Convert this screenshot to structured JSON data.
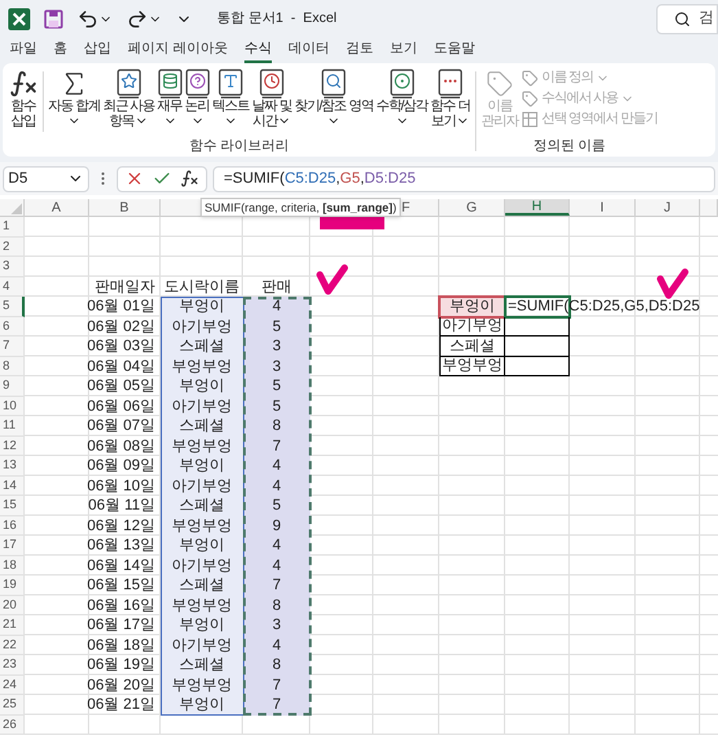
{
  "title_bar": {
    "title": "통합 문서1  -  Excel",
    "search": {
      "placeholder": "검"
    }
  },
  "tabs": [
    {
      "label": "파일",
      "selected": false
    },
    {
      "label": "홈",
      "selected": false
    },
    {
      "label": "삽입",
      "selected": false
    },
    {
      "label": "페이지 레이아웃",
      "selected": false
    },
    {
      "label": "수식",
      "selected": true
    },
    {
      "label": "데이터",
      "selected": false
    },
    {
      "label": "검토",
      "selected": false
    },
    {
      "label": "보기",
      "selected": false
    },
    {
      "label": "도움말",
      "selected": false
    }
  ],
  "function_library": {
    "title": "함수 라이브러리",
    "buttons": [
      {
        "kind": "fx",
        "label": "함수\n삽입",
        "dropdown": false
      },
      {
        "kind": "sigma",
        "label": "자동 합계",
        "dropdown": true
      },
      {
        "kind": "star",
        "label": "최근 사용\n항목",
        "dropdown": true
      },
      {
        "kind": "database",
        "label": "재무",
        "dropdown": true
      },
      {
        "kind": "question",
        "label": "논리",
        "dropdown": true
      },
      {
        "kind": "text",
        "label": "텍스트",
        "dropdown": true
      },
      {
        "kind": "clock",
        "label": "날짜 및\n시간",
        "dropdown": true
      },
      {
        "kind": "search",
        "label": "찾기/참조 영역",
        "dropdown": true
      },
      {
        "kind": "theta",
        "label": "수학/삼각",
        "dropdown": true
      },
      {
        "kind": "dots",
        "label": "함수 더\n보기",
        "dropdown": true
      }
    ]
  },
  "defined_names": {
    "title": "정의된 이름",
    "manager": {
      "label": "이름\n관리자",
      "disabled": true
    },
    "items": [
      {
        "kind": "tag",
        "label": "이름 정의",
        "dropdown": true,
        "disabled": true
      },
      {
        "kind": "formula",
        "label": "수식에서 사용",
        "dropdown": true,
        "disabled": true
      },
      {
        "kind": "table",
        "label": "선택 영역에서 만들기",
        "dropdown": false,
        "disabled": true
      }
    ]
  },
  "formula_bar": {
    "name_box": "D5",
    "segments": [
      {
        "text": "=SUMIF("
      },
      {
        "text": "C5:D25",
        "color": "#2f6db5"
      },
      {
        "text": ","
      },
      {
        "text": "G5",
        "color": "#c0504d"
      },
      {
        "text": ","
      },
      {
        "text": "D5:D25",
        "color": "#7a5ca8"
      }
    ]
  },
  "tooltip": "SUMIF(range, criteria, **[sum_range]**)",
  "sheet": {
    "columns": [
      {
        "label": "A",
        "selected": false
      },
      {
        "label": "B",
        "selected": false
      },
      {},
      {},
      {},
      {
        "label": "F",
        "selected": false
      },
      {
        "label": "G",
        "selected": false
      },
      {
        "label": "H",
        "selected": true
      },
      {
        "label": "I",
        "selected": false
      },
      {
        "label": "J",
        "selected": false
      }
    ],
    "rows": [
      {
        "label": "1",
        "selected": false
      },
      {
        "label": "2",
        "selected": false
      },
      {
        "label": "3",
        "selected": false
      },
      {
        "label": "4",
        "selected": false
      },
      {
        "label": "5",
        "selected": true
      },
      {
        "label": "6",
        "selected": false
      },
      {
        "label": "7",
        "selected": false
      },
      {
        "label": "8",
        "selected": false
      },
      {
        "label": "9",
        "selected": false
      },
      {
        "label": "10",
        "selected": false
      },
      {
        "label": "11",
        "selected": false
      },
      {
        "label": "12",
        "selected": false
      },
      {
        "label": "13",
        "selected": false
      },
      {
        "label": "14",
        "selected": false
      },
      {
        "label": "15",
        "selected": false
      },
      {
        "label": "16",
        "selected": false
      },
      {
        "label": "17",
        "selected": false
      },
      {
        "label": "18",
        "selected": false
      },
      {
        "label": "19",
        "selected": false
      },
      {
        "label": "20",
        "selected": false
      },
      {
        "label": "21",
        "selected": false
      },
      {
        "label": "22",
        "selected": false
      },
      {
        "label": "23",
        "selected": false
      },
      {
        "label": "24",
        "selected": false
      },
      {
        "label": "25",
        "selected": false
      },
      {
        "label": "26",
        "selected": false
      }
    ]
  },
  "table": {
    "range_highlight": true,
    "copy_marquee": true,
    "headers": [
      "판매일자",
      "도시락이름",
      "판매"
    ],
    "rows": [
      {
        "date": "06월 01일",
        "name": "부엉이",
        "sales": "4"
      },
      {
        "date": "06월 02일",
        "name": "아기부엉",
        "sales": "5"
      },
      {
        "date": "06월 03일",
        "name": "스페셜",
        "sales": "3"
      },
      {
        "date": "06월 04일",
        "name": "부엉부엉",
        "sales": "3"
      },
      {
        "date": "06월 05일",
        "name": "부엉이",
        "sales": "5"
      },
      {
        "date": "06월 06일",
        "name": "아기부엉",
        "sales": "5"
      },
      {
        "date": "06월 07일",
        "name": "스페셜",
        "sales": "8"
      },
      {
        "date": "06월 08일",
        "name": "부엉부엉",
        "sales": "7"
      },
      {
        "date": "06월 09일",
        "name": "부엉이",
        "sales": "4"
      },
      {
        "date": "06월 10일",
        "name": "아기부엉",
        "sales": "4"
      },
      {
        "date": "06월 11일",
        "name": "스페셜",
        "sales": "5"
      },
      {
        "date": "06월 12일",
        "name": "부엉부엉",
        "sales": "9"
      },
      {
        "date": "06월 13일",
        "name": "부엉이",
        "sales": "4"
      },
      {
        "date": "06월 14일",
        "name": "아기부엉",
        "sales": "4"
      },
      {
        "date": "06월 15일",
        "name": "스페셜",
        "sales": "7"
      },
      {
        "date": "06월 16일",
        "name": "부엉부엉",
        "sales": "8"
      },
      {
        "date": "06월 17일",
        "name": "부엉이",
        "sales": "3"
      },
      {
        "date": "06월 18일",
        "name": "아기부엉",
        "sales": "4"
      },
      {
        "date": "06월 19일",
        "name": "스페셜",
        "sales": "8"
      },
      {
        "date": "06월 20일",
        "name": "부엉부엉",
        "sales": "7"
      },
      {
        "date": "06월 21일",
        "name": "부엉이",
        "sales": "7"
      }
    ]
  },
  "lookup": {
    "rows": [
      {
        "name": "부엉이",
        "criteria": true,
        "editing": true,
        "value": "=SUMIF(C5:D25,G5,D5:D25"
      },
      {
        "name": "아기부엉",
        "criteria": false,
        "editing": false
      },
      {
        "name": "스페셜",
        "criteria": false,
        "editing": false
      },
      {
        "name": "부엉부엉",
        "criteria": false,
        "editing": false
      }
    ]
  },
  "annotations": [
    {
      "kind": "bar",
      "color": "#e6007e"
    },
    {
      "kind": "check",
      "color": "#e6007e"
    },
    {
      "kind": "check",
      "color": "#e6007e"
    }
  ]
}
